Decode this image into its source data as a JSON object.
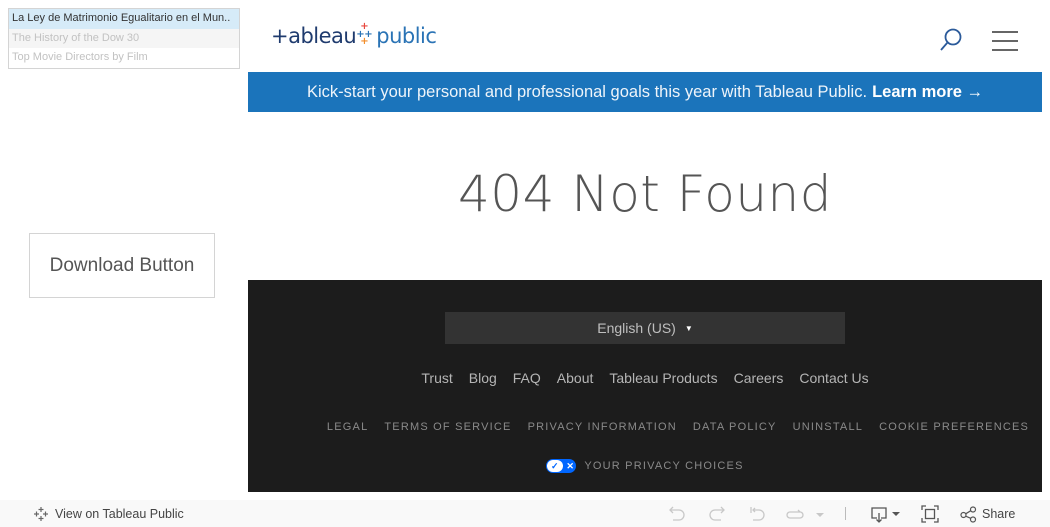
{
  "viz_list": {
    "items": [
      {
        "label": "La Ley de Matrimonio Egualitario en el Mun..",
        "state": "selected"
      },
      {
        "label": "The History of the Dow 30",
        "state": "alt"
      },
      {
        "label": "Top Movie Directors by Film",
        "state": "dim"
      }
    ]
  },
  "download_button": {
    "label": "Download Button"
  },
  "header": {
    "logo": {
      "part1": "+ableau",
      "part2": "public"
    },
    "search_icon": "search-icon",
    "menu_icon": "hamburger-menu-icon"
  },
  "banner": {
    "message": "Kick-start your personal and professional goals this year with Tableau Public.",
    "link_label": "Learn more →",
    "color": "#1b74bb"
  },
  "error": {
    "title": "404 Not Found"
  },
  "footer": {
    "language": {
      "selected": "English (US)"
    },
    "links": [
      "Trust",
      "Blog",
      "FAQ",
      "About",
      "Tableau Products",
      "Careers",
      "Contact Us"
    ],
    "legal_links": [
      "LEGAL",
      "TERMS OF SERVICE",
      "PRIVACY INFORMATION",
      "DATA POLICY",
      "UNINSTALL",
      "COOKIE PREFERENCES"
    ],
    "privacy_choices": {
      "label": "YOUR PRIVACY CHOICES",
      "toggle_color": "#0066ff"
    }
  },
  "toolbar": {
    "view_on_label": "View on Tableau Public",
    "share_label": "Share",
    "icons": [
      "undo-icon",
      "redo-icon",
      "revert-icon",
      "refresh-icon",
      "pause-dropdown-icon",
      "download-icon",
      "fullscreen-icon",
      "share-icon"
    ]
  }
}
